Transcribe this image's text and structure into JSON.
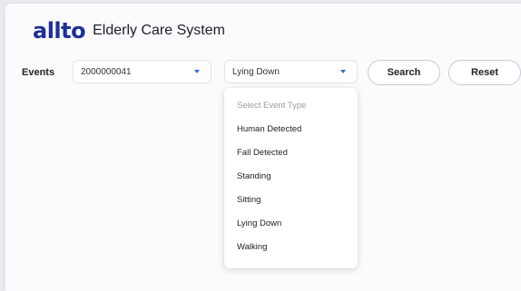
{
  "header": {
    "logo": "allto",
    "title": "Elderly Care System"
  },
  "filters": {
    "events_label": "Events",
    "device_select": {
      "value": "2000000041"
    },
    "event_type_select": {
      "value": "Lying Down",
      "placeholder": "Select Event Type",
      "options": [
        "Human Detected",
        "Fall Detected",
        "Standing",
        "Sitting",
        "Lying Down",
        "Walking"
      ]
    },
    "search_label": "Search",
    "reset_label": "Reset"
  },
  "colors": {
    "brand": "#1e2f97",
    "caret": "#2e6bd8",
    "background": "#e9e9ee",
    "card": "#fbfbfd"
  }
}
